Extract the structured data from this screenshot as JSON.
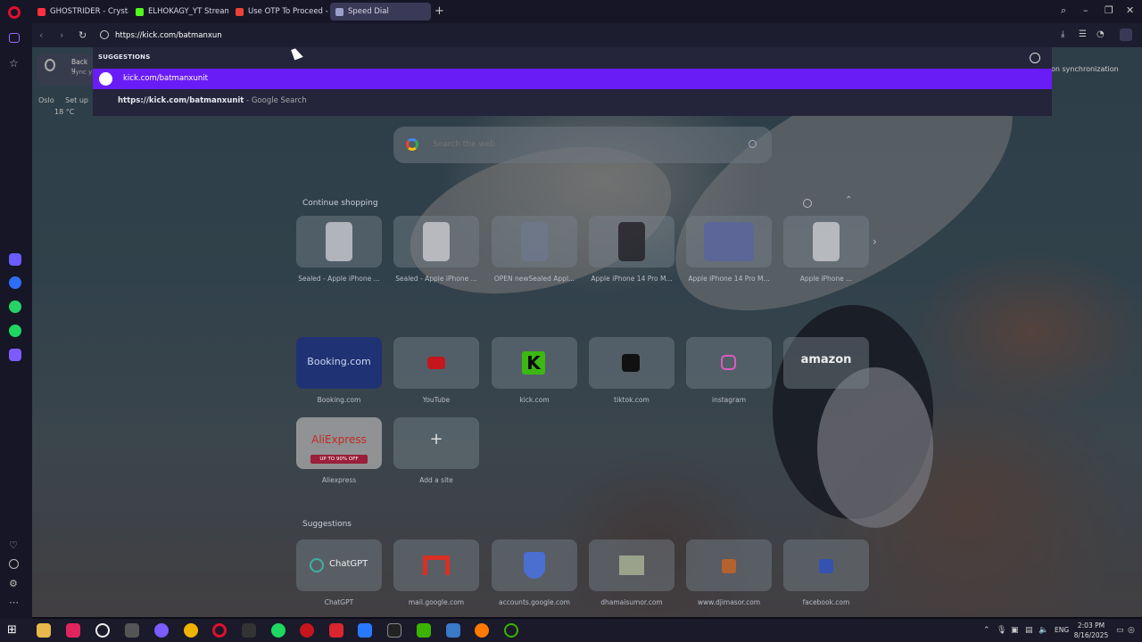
{
  "browser": {
    "tabs": [
      {
        "label": "GHOSTRIDER - Crystal Ca",
        "favicon_color": "#ff3040"
      },
      {
        "label": "ELHOKAGY_YT Stream - V",
        "favicon_color": "#53fc18"
      },
      {
        "label": "Use OTP To Proceed - raf",
        "favicon_color": "#ea4335"
      },
      {
        "label": "Speed Dial",
        "favicon_color": "#9aa0c8"
      }
    ],
    "new_tab_icon": "plus-icon",
    "address_value": "https://kick.com/batmanxunit"
  },
  "suggestions": {
    "heading": "SUGGESTIONS",
    "items": [
      {
        "text": "kick.com/batmanxunit",
        "icon": "globe-icon"
      },
      {
        "bold": "https://kick.com/batmanxunit",
        "suffix": " - Google Search"
      }
    ]
  },
  "background_page": {
    "news_title": "Back u",
    "news_sub": "Sync y",
    "setup_label": "Set up",
    "weather_city": "Oslo",
    "weather_temp": "18 °C",
    "sync_text": "on synchronization",
    "search_placeholder": "Search the web",
    "continue_shopping": "Continue shopping",
    "shopping": [
      "Sealed - Apple iPhone ...",
      "Sealed - Apple iPhone ...",
      "OPEN newSealed Appl...",
      "Apple iPhone 14 Pro M...",
      "Apple iPhone 14 Pro M...",
      "Apple iPhone ..."
    ],
    "speed_dial": [
      {
        "name": "Booking.com",
        "label": "Booking.com",
        "color": "#243d8c"
      },
      {
        "name": "",
        "label": "YouTube",
        "color": "#ff0000"
      },
      {
        "name": "",
        "label": "kick.com",
        "color": "#53fc18"
      },
      {
        "name": "",
        "label": "tiktok.com",
        "color": "#111111"
      },
      {
        "name": "",
        "label": "instagram",
        "color": "#d62976"
      },
      {
        "name": "amazon",
        "label": "",
        "color": "#ffffff"
      },
      {
        "name": "AliExpress",
        "label": "Aliexpress",
        "color": "#e62e04"
      },
      {
        "name": "+",
        "label": "Add a site",
        "color": "#cccccc"
      }
    ],
    "aliexpress_badge": "UP TO 90% OFF",
    "suggestions_label": "Suggestions",
    "suggested_sites": [
      {
        "name": "ChatGPT",
        "label": "ChatGPT"
      },
      {
        "name": "",
        "label": "mail.google.com"
      },
      {
        "name": "",
        "label": "accounts.google.com"
      },
      {
        "name": "",
        "label": "dhamaisumor.com"
      },
      {
        "name": "",
        "label": "www.djimasor.com"
      },
      {
        "name": "",
        "label": "facebook.com"
      }
    ]
  },
  "taskbar": {
    "time": "2:03 PM",
    "date": "8/16/2025",
    "language": "ENG"
  }
}
